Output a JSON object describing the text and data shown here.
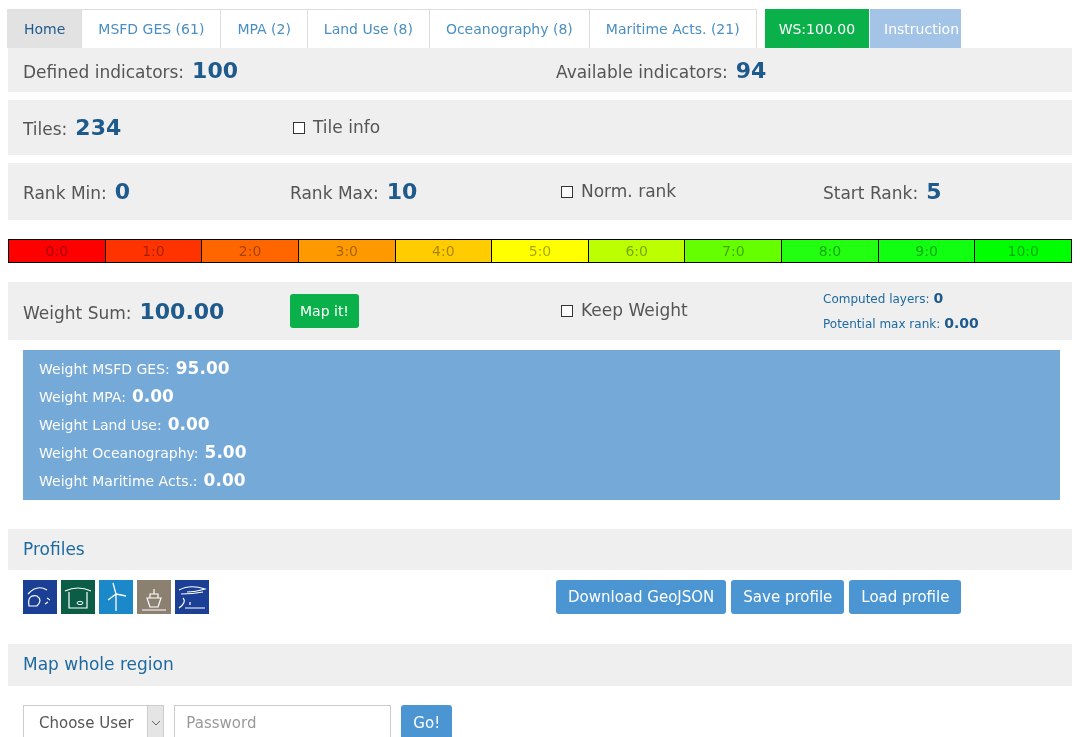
{
  "tabs": [
    {
      "label": "Home",
      "selected": true,
      "kind": "tab"
    },
    {
      "label": "MSFD GES (61)",
      "selected": false,
      "kind": "tab"
    },
    {
      "label": "MPA (2)",
      "selected": false,
      "kind": "tab"
    },
    {
      "label": "Land Use (8)",
      "selected": false,
      "kind": "tab"
    },
    {
      "label": "Oceanography (8)",
      "selected": false,
      "kind": "tab"
    },
    {
      "label": "Maritime Acts. (21)",
      "selected": false,
      "kind": "tab"
    },
    {
      "label": "WS:100.00",
      "selected": false,
      "kind": "status"
    },
    {
      "label": "Instruction",
      "selected": false,
      "kind": "info"
    }
  ],
  "indicators": {
    "defined_label": "Defined indicators:",
    "defined": "100",
    "available_label": "Available indicators:",
    "available": "94"
  },
  "tiles": {
    "label": "Tiles:",
    "value": "234",
    "tile_info": {
      "label": "Tile info",
      "checked": false
    }
  },
  "rank": {
    "min_label": "Rank Min:",
    "min": "0",
    "max_label": "Rank Max:",
    "max": "10",
    "norm_rank": {
      "label": "Norm. rank",
      "checked": false
    },
    "start_label": "Start Rank:",
    "start": "5"
  },
  "scale": [
    {
      "label": "0:0",
      "color": "#ff0000"
    },
    {
      "label": "1:0",
      "color": "#ff3300"
    },
    {
      "label": "2:0",
      "color": "#ff6600"
    },
    {
      "label": "3:0",
      "color": "#ff9900"
    },
    {
      "label": "4:0",
      "color": "#ffcc00"
    },
    {
      "label": "5:0",
      "color": "#ffff00"
    },
    {
      "label": "6:0",
      "color": "#bbff00"
    },
    {
      "label": "7:0",
      "color": "#66ff00"
    },
    {
      "label": "8:0",
      "color": "#22ff11"
    },
    {
      "label": "9:0",
      "color": "#11ff11"
    },
    {
      "label": "10:0",
      "color": "#00ff00"
    }
  ],
  "weight": {
    "sum_label": "Weight Sum:",
    "sum": "100.00",
    "map_button": "Map it!",
    "keep_weight": {
      "label": "Keep Weight",
      "checked": false
    },
    "computed_label": "Computed layers:",
    "computed": "0",
    "potential_label": "Potential max rank:",
    "potential": "0.00"
  },
  "weights": [
    {
      "label": "Weight MSFD GES:",
      "value": "95.00"
    },
    {
      "label": "Weight MPA:",
      "value": "0.00"
    },
    {
      "label": "Weight Land Use:",
      "value": "0.00"
    },
    {
      "label": "Weight Oceanography:",
      "value": "5.00"
    },
    {
      "label": "Weight Maritime Acts.:",
      "value": "0.00"
    }
  ],
  "profiles": {
    "title": "Profiles",
    "icons": [
      {
        "kind": "fish",
        "color": "#1a3f94"
      },
      {
        "kind": "habitat",
        "color": "#0b5e45"
      },
      {
        "kind": "turbine",
        "color": "#1a88c9"
      },
      {
        "kind": "ship",
        "color": "#8c8070"
      },
      {
        "kind": "coast",
        "color": "#1a3f94"
      }
    ],
    "buttons": [
      "Download GeoJSON",
      "Save profile",
      "Load profile"
    ]
  },
  "map_region": {
    "title": "Map whole region",
    "user_select": "Choose User",
    "password_placeholder": "Password",
    "go": "Go!"
  }
}
